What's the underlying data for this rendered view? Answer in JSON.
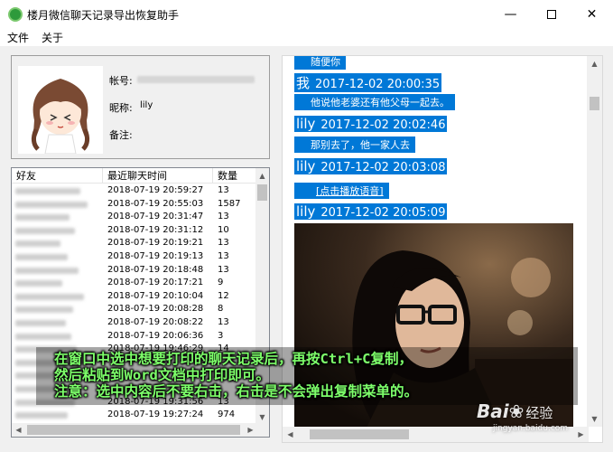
{
  "window": {
    "title": "楼月微信聊天记录导出恢复助手",
    "controls": {
      "minimize": "—",
      "close": "✕"
    }
  },
  "menu": {
    "file": "文件",
    "about": "关于"
  },
  "profile": {
    "account_label": "帐号:",
    "nick_label": "昵称:",
    "nick_value": "lily",
    "note_label": "备注:"
  },
  "friends_list": {
    "headers": {
      "friend": "好友",
      "last_time": "最近聊天时间",
      "count": "数量"
    },
    "rows": [
      {
        "time": "2018-07-19 20:59:27",
        "count": "13"
      },
      {
        "time": "2018-07-19 20:55:03",
        "count": "1587"
      },
      {
        "time": "2018-07-19 20:31:47",
        "count": "13"
      },
      {
        "time": "2018-07-19 20:31:12",
        "count": "10"
      },
      {
        "time": "2018-07-19 20:19:21",
        "count": "13"
      },
      {
        "time": "2018-07-19 20:19:13",
        "count": "13"
      },
      {
        "time": "2018-07-19 20:18:48",
        "count": "13"
      },
      {
        "time": "2018-07-19 20:17:21",
        "count": "9"
      },
      {
        "time": "2018-07-19 20:10:04",
        "count": "12"
      },
      {
        "time": "2018-07-19 20:08:28",
        "count": "8"
      },
      {
        "time": "2018-07-19 20:08:22",
        "count": "13"
      },
      {
        "time": "2018-07-19 20:06:36",
        "count": "3"
      },
      {
        "time": "2018-07-19 19:46:29",
        "count": "14"
      },
      {
        "time": "",
        "count": ""
      },
      {
        "time": "",
        "count": ""
      },
      {
        "time": "",
        "count": ""
      },
      {
        "time": "2018-07-19 19:31:56",
        "count": "13"
      },
      {
        "time": "2018-07-19 19:27:24",
        "count": "974"
      }
    ]
  },
  "chat": {
    "msg_top": "随便你",
    "msg1_who": "我",
    "msg1_time": "2017-12-02 20:00:35",
    "msg1_text": "他说他老婆还有他父母一起去。",
    "msg2_who": "lily",
    "msg2_time": "2017-12-02 20:02:46",
    "msg2_text": "那别去了，他一家人去",
    "msg3_who": "lily",
    "msg3_time": "2017-12-02 20:03:08",
    "msg3_text": "[点击播放语音]",
    "msg4_who": "lily",
    "msg4_time": "2017-12-02 20:05:09"
  },
  "caption": {
    "line1": "在窗口中选中想要打印的聊天记录后，再按Ctrl+C复制，",
    "line2": "然后粘贴到Word文档中打印即可。",
    "line3": "注意：选中内容后不要右击，右击是不会弹出复制菜单的。"
  },
  "watermark": {
    "logo": "Bai",
    "sub": "经验",
    "url": "jingyan.baidu.com"
  },
  "colors": {
    "selection": "#0078d7",
    "caption": "#7dff6a",
    "app_icon": "#2e9a3b"
  }
}
